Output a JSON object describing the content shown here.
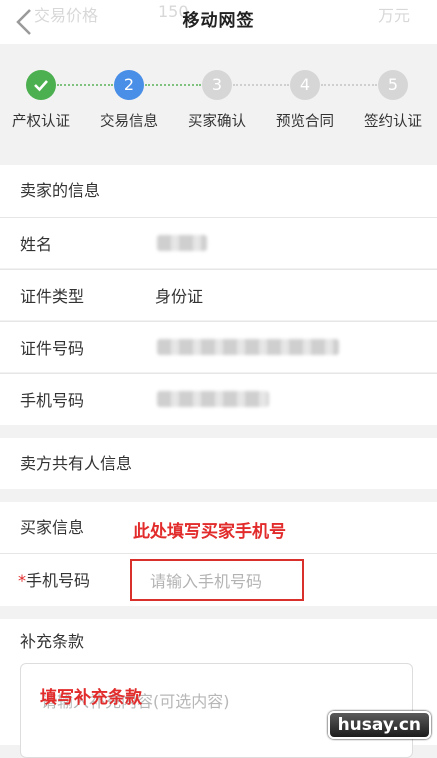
{
  "header": {
    "title": "移动网签",
    "ghost_left": "交易价格",
    "ghost_mid": "150",
    "ghost_right": "万元"
  },
  "steps": [
    {
      "label": "产权认证",
      "number": "",
      "state": "done"
    },
    {
      "label": "交易信息",
      "number": "2",
      "state": "current"
    },
    {
      "label": "买家确认",
      "number": "3",
      "state": "pending"
    },
    {
      "label": "预览合同",
      "number": "4",
      "state": "pending"
    },
    {
      "label": "签约认证",
      "number": "5",
      "state": "pending"
    }
  ],
  "seller": {
    "section_title": "卖家的信息",
    "name_label": "姓名",
    "id_type_label": "证件类型",
    "id_type_value": "身份证",
    "id_number_label": "证件号码",
    "phone_label": "手机号码"
  },
  "co_owner": {
    "section_title": "卖方共有人信息"
  },
  "buyer": {
    "section_title": "买家信息",
    "annotation": "此处填写买家手机号",
    "required_mark": "*",
    "phone_label": "手机号码",
    "phone_placeholder": "请输入手机号码"
  },
  "supplement": {
    "section_title": "补充条款",
    "annotation": "填写补充条款",
    "placeholder": "请输入补充内容(可选内容)"
  },
  "watermark": "husay.cn",
  "colors": {
    "done": "#4caf50",
    "current": "#4a8fe7",
    "pending": "#d6d6d6",
    "annotation": "#e22b2b"
  }
}
